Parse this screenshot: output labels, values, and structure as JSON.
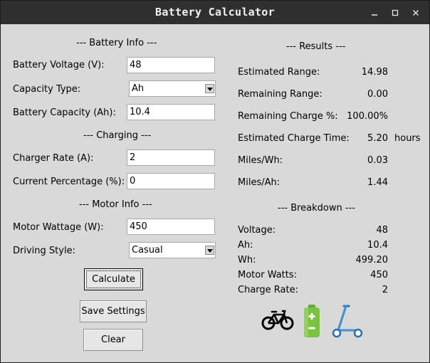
{
  "window": {
    "title": "Battery Calculator"
  },
  "battery": {
    "section": "--- Battery Info ---",
    "voltage_label": "Battery Voltage (V):",
    "voltage_value": "48",
    "capacity_type_label": "Capacity Type:",
    "capacity_type_value": "Ah",
    "capacity_label": "Battery Capacity (Ah):",
    "capacity_value": "10.4"
  },
  "charging": {
    "section": "--- Charging ---",
    "rate_label": "Charger Rate (A):",
    "rate_value": "2",
    "percent_label": "Current Percentage (%):",
    "percent_value": "0"
  },
  "motor": {
    "section": "--- Motor Info ---",
    "wattage_label": "Motor Wattage (W):",
    "wattage_value": "450",
    "style_label": "Driving Style:",
    "style_value": "Casual"
  },
  "buttons": {
    "calculate": "Calculate",
    "save": "Save Settings",
    "clear": "Clear"
  },
  "results": {
    "section": "--- Results ---",
    "range_label": "Estimated Range:",
    "range_value": "14.98",
    "remaining_label": "Remaining Range:",
    "remaining_value": "0.00",
    "charge_label": "Remaining Charge %:",
    "charge_value": "100.00%",
    "time_label": "Estimated Charge Time:",
    "time_value": "5.20",
    "time_unit": "hours",
    "mpwh_label": "Miles/Wh:",
    "mpwh_value": "0.03",
    "mpah_label": "Miles/Ah:",
    "mpah_value": "1.44"
  },
  "breakdown": {
    "section": "--- Breakdown ---",
    "voltage_label": "Voltage:",
    "voltage_value": "48",
    "ah_label": "Ah:",
    "ah_value": "10.4",
    "wh_label": "Wh:",
    "wh_value": "499.20",
    "watts_label": "Motor Watts:",
    "watts_value": "450",
    "rate_label": "Charge Rate:",
    "rate_value": "2"
  },
  "icons": [
    "bicycle-icon",
    "battery-icon",
    "scooter-icon"
  ],
  "colors": {
    "battery": "#7cc242",
    "scooter": "#3d8fd6",
    "titlebar": "#2f2f2f",
    "background": "#d9d9d9"
  }
}
